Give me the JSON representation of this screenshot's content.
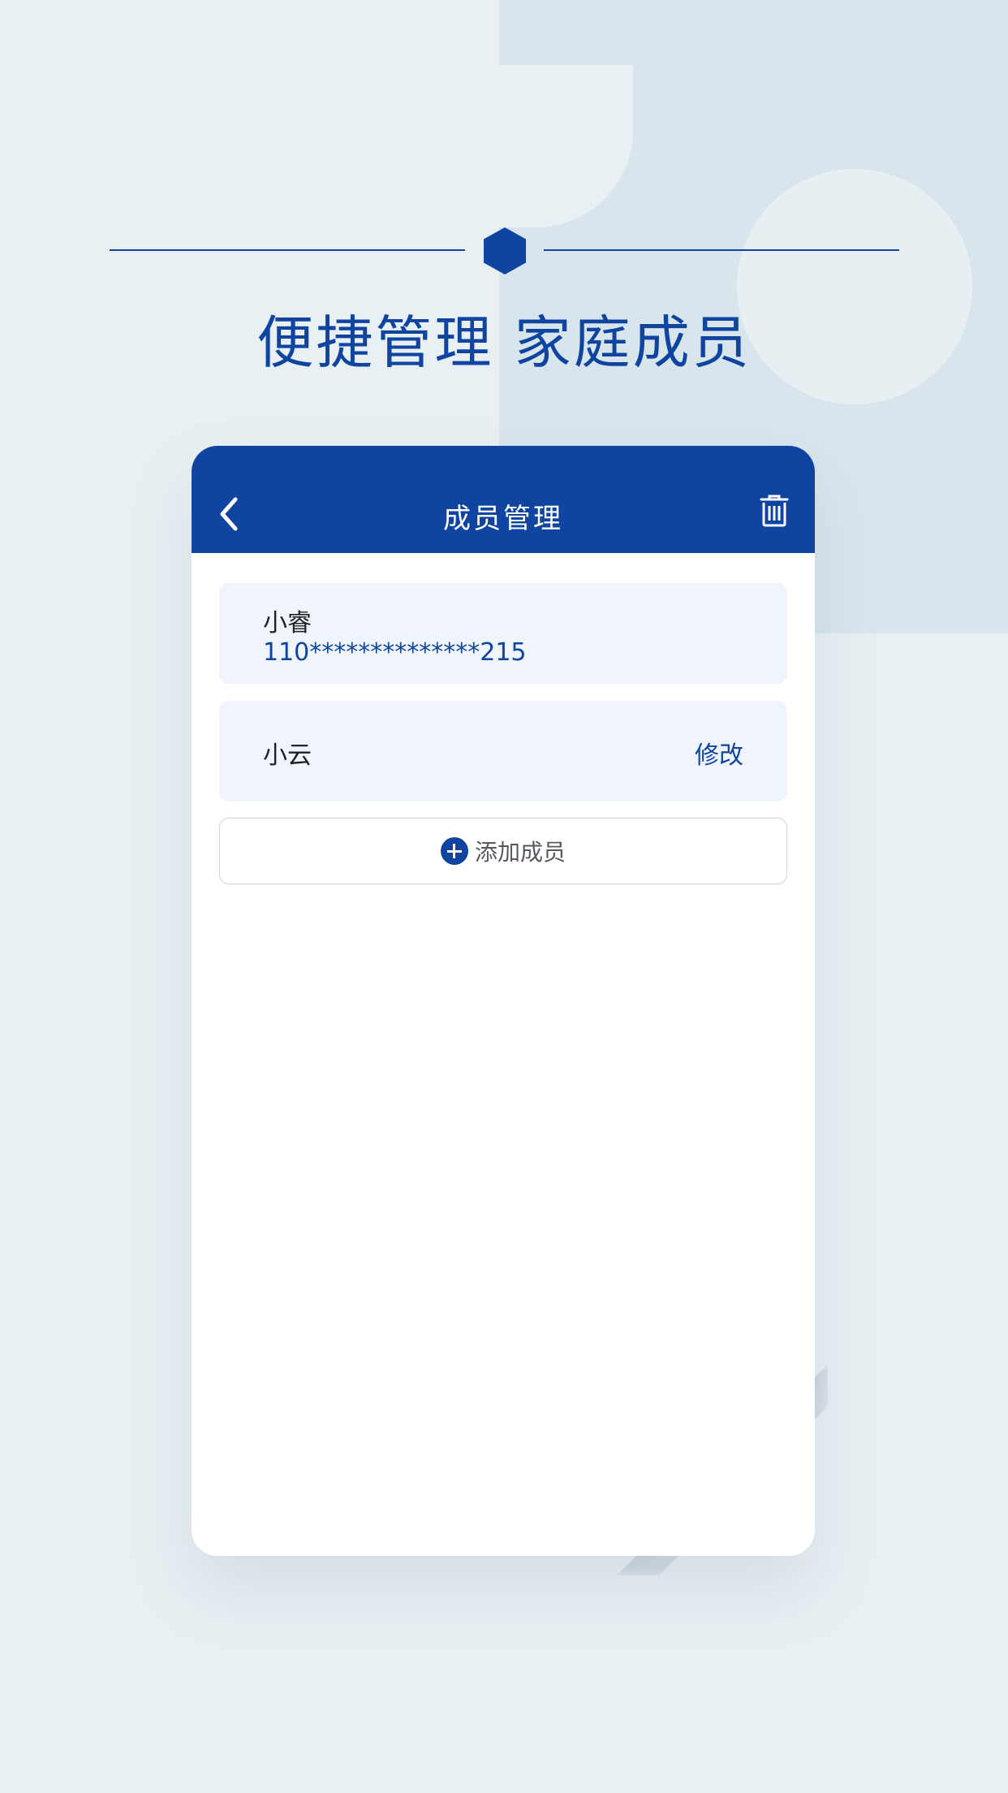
{
  "hero": {
    "title": "便捷管理 家庭成员"
  },
  "screen": {
    "header": {
      "title": "成员管理",
      "back_icon": "chevron-left-icon",
      "delete_icon": "trash-icon"
    },
    "members": [
      {
        "name": "小睿",
        "id_masked": "110**************215"
      },
      {
        "name": "小云",
        "action": "修改"
      }
    ],
    "add_member": {
      "label": "添加成员",
      "icon": "plus-circle-icon"
    }
  },
  "colors": {
    "brand": "#0f45a0",
    "background": "#e9f0f4",
    "member_card_bg": "#f0f5fd"
  }
}
